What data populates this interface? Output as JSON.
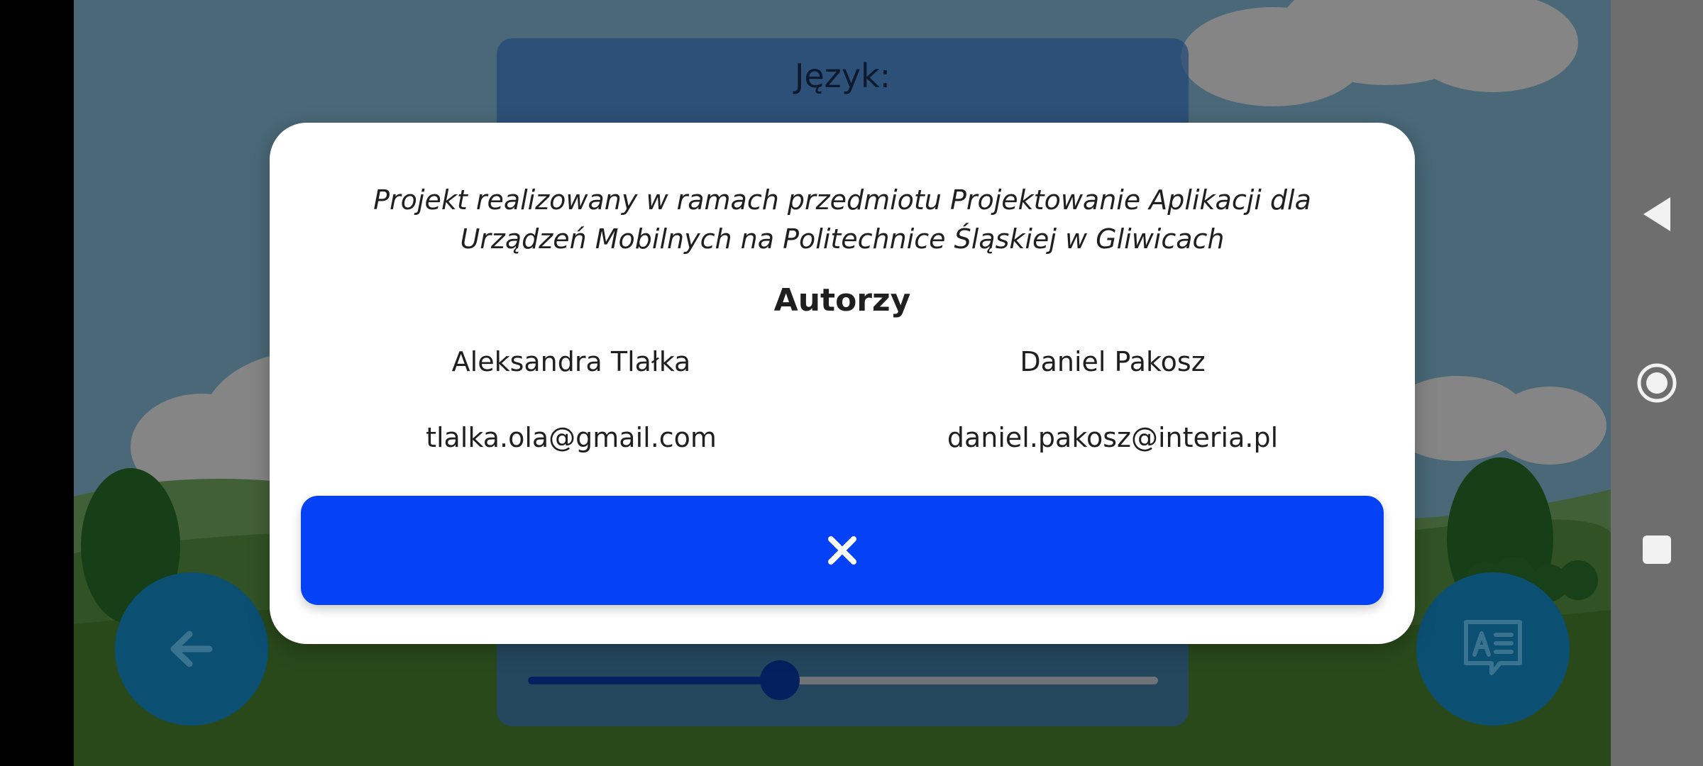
{
  "settings": {
    "language_label": "Język:",
    "slider_value_percent": 40
  },
  "dialog": {
    "description": "Projekt realizowany w ramach przedmiotu Projektowanie Aplikacji dla Urządzeń Mobilnych na Politechnice Śląskiej w Gliwicach",
    "authors_heading": "Autorzy",
    "authors": [
      {
        "name": "Aleksandra Tlałka",
        "email": "tlalka.ola@gmail.com"
      },
      {
        "name": "Daniel Pakosz",
        "email": "daniel.pakosz@interia.pl"
      }
    ],
    "close_icon": "close-icon"
  },
  "buttons": {
    "back_icon": "arrow-left-icon",
    "doc_icon": "document-text-icon"
  },
  "navbar": {
    "back_icon": "triangle-back-icon",
    "home_icon": "circle-home-icon",
    "recents_icon": "square-recents-icon"
  },
  "colors": {
    "accent": "#0541f5",
    "slider_fill": "#04205e",
    "round_button": "#0b4f73"
  }
}
